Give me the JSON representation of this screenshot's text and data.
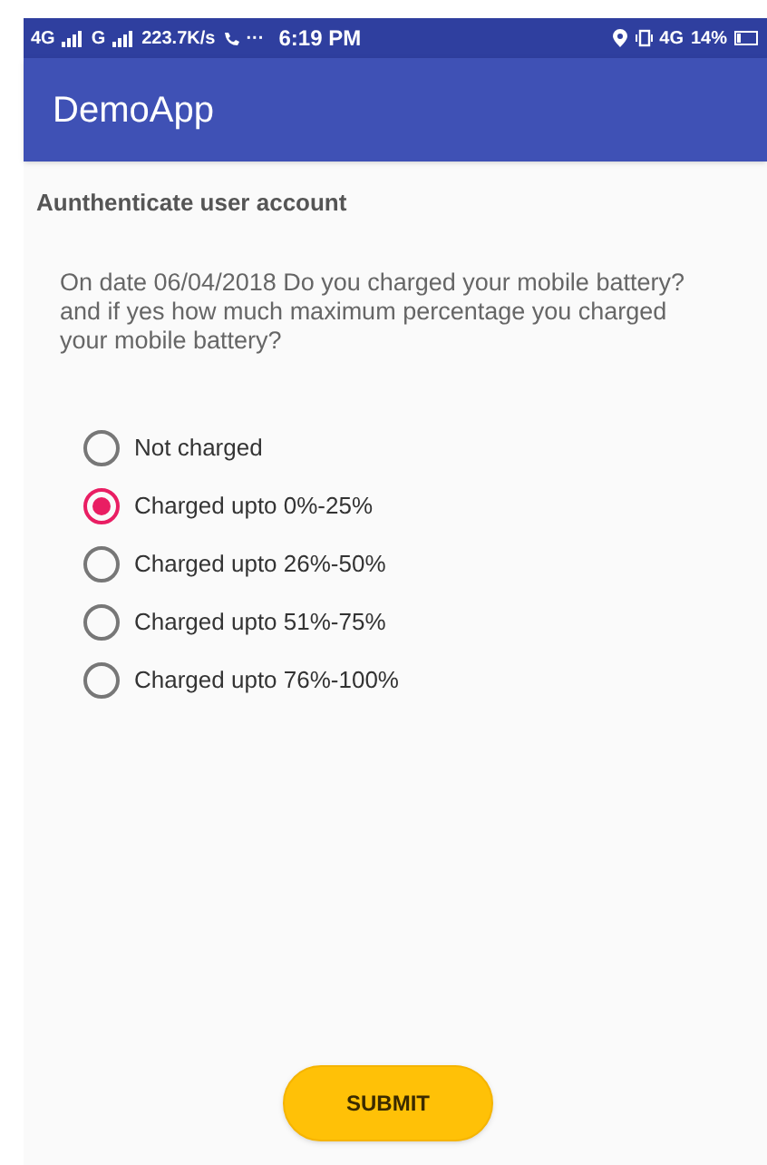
{
  "status_bar": {
    "network_1": "4G",
    "network_2": "G",
    "speed": "223.7K/s",
    "more": "···",
    "time": "6:19 PM",
    "network_3": "4G",
    "battery": "14%"
  },
  "app_bar": {
    "title": "DemoApp"
  },
  "header": "Aunthenticate user account",
  "question": "On date 06/04/2018 Do you charged your mobile battery? and if yes how much maximum percentage you charged your mobile battery?",
  "options": [
    {
      "label": "Not charged",
      "selected": false
    },
    {
      "label": "Charged upto 0%-25%",
      "selected": true
    },
    {
      "label": "Charged upto 26%-50%",
      "selected": false
    },
    {
      "label": "Charged upto 51%-75%",
      "selected": false
    },
    {
      "label": "Charged upto 76%-100%",
      "selected": false
    }
  ],
  "submit": "SUBMIT"
}
